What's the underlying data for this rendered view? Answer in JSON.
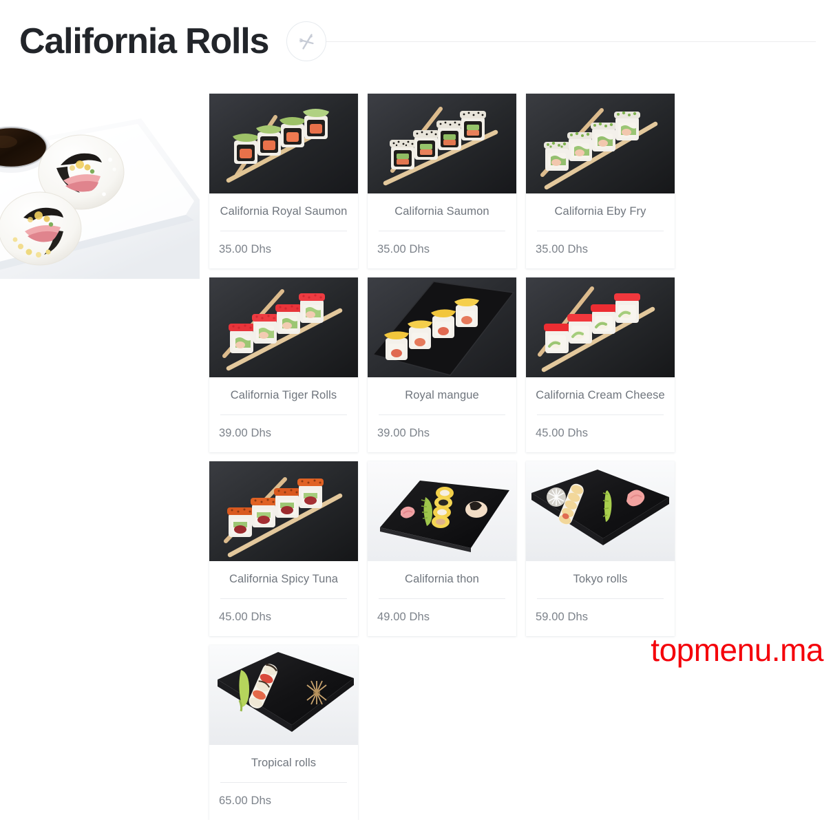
{
  "header": {
    "title": "California Rolls",
    "icon": "fork-knife-circle-icon",
    "rule_color": "#ececee"
  },
  "hero": {
    "alt": "sushi-rolls-on-white-plate-with-soy-sauce",
    "description": "Two California rolls on a white rectangular plate beside a bowl of soy sauce"
  },
  "cards": [
    {
      "name": "California Royal Saumon",
      "price": "35.00 Dhs",
      "photo": "avocado-topped-rolls-dark-background"
    },
    {
      "name": "California Saumon",
      "price": "35.00 Dhs",
      "photo": "sesame-salmon-rolls-dark-background"
    },
    {
      "name": "California Eby Fry",
      "price": "35.00 Dhs",
      "photo": "green-herb-topped-rolls-dark-background"
    },
    {
      "name": "California Tiger Rolls",
      "price": "39.00 Dhs",
      "photo": "red-tobiko-rolls-dark-background"
    },
    {
      "name": "Royal mangue",
      "price": "39.00 Dhs",
      "photo": "mango-topped-rolls-on-slate"
    },
    {
      "name": "California Cream Cheese",
      "price": "45.00 Dhs",
      "photo": "red-tobiko-cream-cheese-rolls"
    },
    {
      "name": "California Spicy Tuna",
      "price": "45.00 Dhs",
      "photo": "spicy-tuna-rolls-dark-background"
    },
    {
      "name": "California thon",
      "price": "49.00 Dhs",
      "photo": "yellow-wrapped-rolls-on-black-slate"
    },
    {
      "name": "Tokyo rolls",
      "price": "59.00 Dhs",
      "photo": "tokyo-rolls-on-black-slate-plate"
    },
    {
      "name": "Tropical rolls",
      "price": "65.00 Dhs",
      "photo": "tropical-rolls-on-black-slate-plate"
    }
  ],
  "watermark": {
    "text": "topmenu.ma",
    "color": "#f4020a"
  },
  "colors": {
    "title": "#22252a",
    "card_text": "#6f757d",
    "price_text": "#7c828a",
    "divider": "#e9ebee",
    "page_background": "#ffffff"
  }
}
